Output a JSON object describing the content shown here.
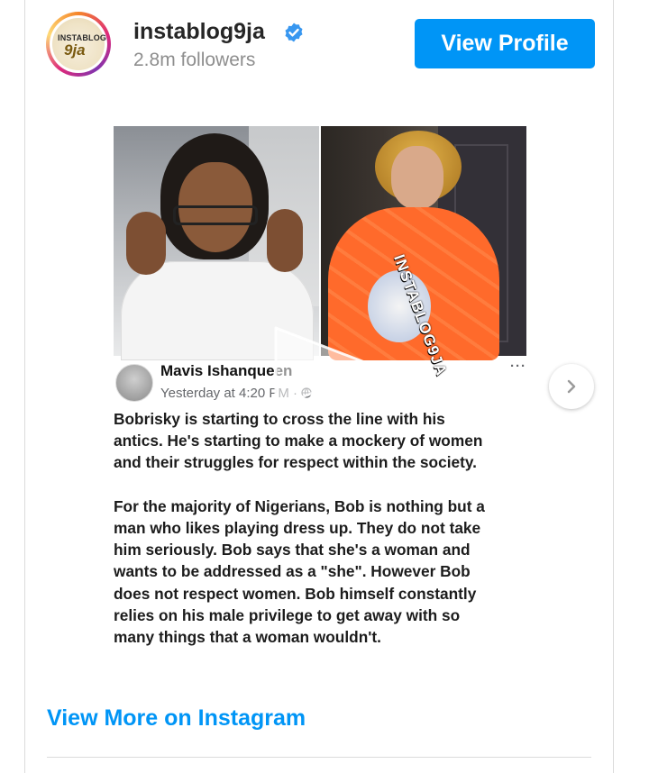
{
  "header": {
    "username": "instablog9ja",
    "followers": "2.8m followers",
    "view_profile_label": "View Profile",
    "avatar_text_top": "INSTABLOG",
    "avatar_text_main": "9ja"
  },
  "post": {
    "watermark": "INSTABLOG9JA",
    "fb_author": "Mavis Ishanqueen",
    "fb_time": "Yesterday at 4:20 PM · ",
    "fb_more": "···",
    "fb_text": "Bobrisky is starting to cross the line with his\nantics. He's starting to make a mockery of women\nand their struggles for respect within the society.\n\nFor the majority of Nigerians, Bob is nothing but a\nman who likes playing dress up. They do not take\nhim seriously. Bob says that she's a woman and\nwants to be addressed as a \"she\". However Bob\ndoes not respect women. Bob himself constantly\nrelies on his male privilege to get away with so\nmany things that a woman wouldn't."
  },
  "footer": {
    "view_more_label": "View More on Instagram"
  },
  "colors": {
    "accent": "#0095f6",
    "verified": "#3897f0",
    "muted": "#8e8e8e"
  },
  "icons": [
    "verified-badge-icon",
    "play-icon",
    "chevron-right-icon",
    "globe-icon"
  ]
}
